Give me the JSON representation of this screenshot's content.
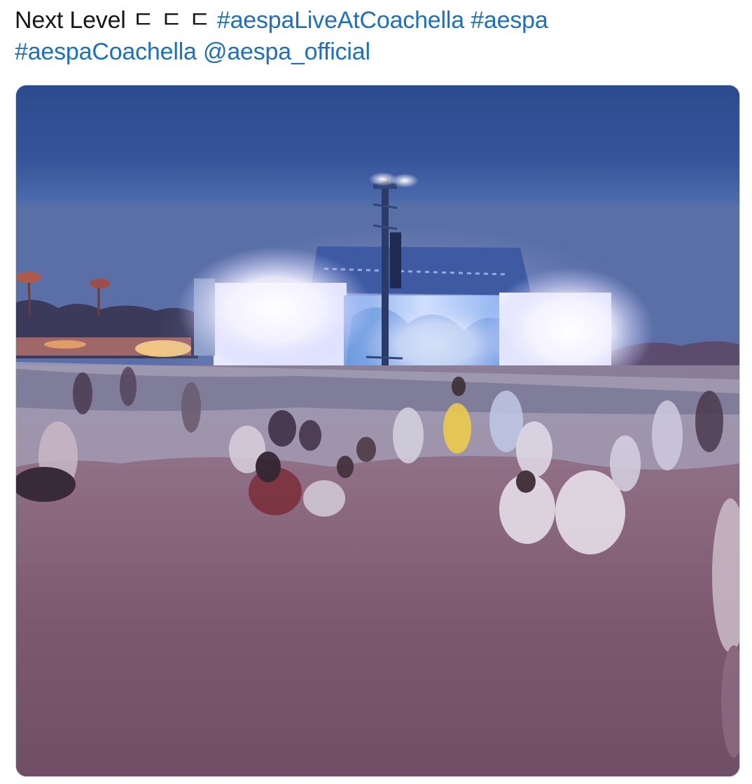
{
  "tweet": {
    "text_prefix": "Next Level ",
    "text_glyphs": "ㄷ ㄷ ㄷ",
    "hashtags": [
      "#aespaLiveAtCoachella",
      "#aespa",
      "#aespaCoachella"
    ],
    "mention": "@aespa_official"
  },
  "media": {
    "type": "video-thumbnail",
    "depicts": "concert-stage-crowd-dusk"
  },
  "colors": {
    "text": "#14171a",
    "link": "#1b6fc4",
    "border": "#cfd9de"
  }
}
